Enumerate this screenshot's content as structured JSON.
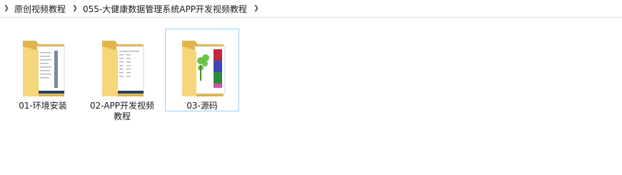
{
  "breadcrumb": {
    "items": [
      {
        "label": "原创视频教程"
      },
      {
        "label": "055-大健康数据管理系统APP开发视频教程"
      }
    ]
  },
  "folders": [
    {
      "label": "01-环境安装",
      "icon": "folder-icon",
      "selected": false
    },
    {
      "label": "02-APP开发视频教程",
      "icon": "folder-icon",
      "selected": false
    },
    {
      "label": "03-源码",
      "icon": "folder-icon",
      "selected": true
    }
  ],
  "colors": {
    "folder_yellow": "#f7d67a",
    "folder_dark": "#e0b44a",
    "selection_border": "#99d1ff"
  }
}
